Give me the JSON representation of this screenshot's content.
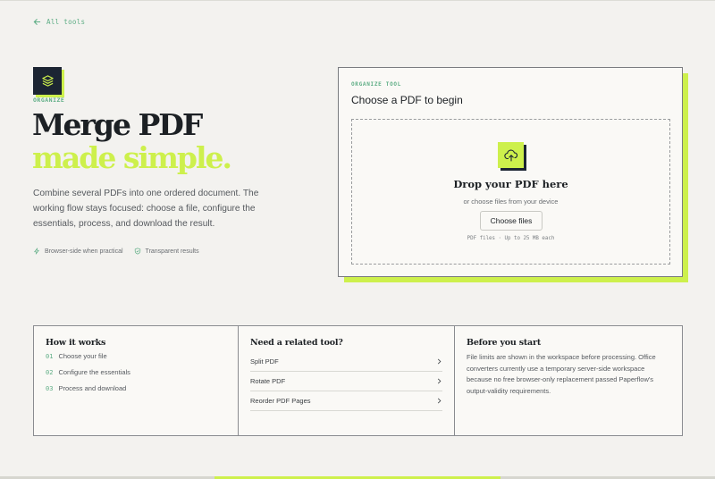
{
  "nav": {
    "back_label": "All tools"
  },
  "hero": {
    "category": "ORGANIZE",
    "title_line1": "Merge PDF",
    "title_line2": "made simple.",
    "description": "Combine several PDFs into one ordered document. The working flow stays focused: choose a file, configure the essentials, process, and download the result.",
    "badges": [
      "Browser-side when practical",
      "Transparent results"
    ]
  },
  "upload": {
    "eyebrow": "ORGANIZE TOOL",
    "title": "Choose a PDF to begin",
    "drop_title": "Drop your PDF here",
    "drop_subtitle": "or choose files from your device",
    "button_label": "Choose files",
    "limit_text": "PDF files · Up to 25 MB each"
  },
  "how_it_works": {
    "title": "How it works",
    "steps": [
      {
        "num": "01",
        "label": "Choose your file"
      },
      {
        "num": "02",
        "label": "Configure the essentials"
      },
      {
        "num": "03",
        "label": "Process and download"
      }
    ]
  },
  "related": {
    "title": "Need a related tool?",
    "items": [
      "Split PDF",
      "Rotate PDF",
      "Reorder PDF Pages"
    ]
  },
  "before": {
    "title": "Before you start",
    "text": "File limits are shown in the workspace before processing. Office converters currently use a temporary server-side workspace because no free browser-only replacement passed Paperflow's output-validity requirements."
  },
  "colors": {
    "accent": "#cdf04c",
    "green": "#5fae86",
    "navy": "#1c2533",
    "background": "#f3f2ef"
  }
}
